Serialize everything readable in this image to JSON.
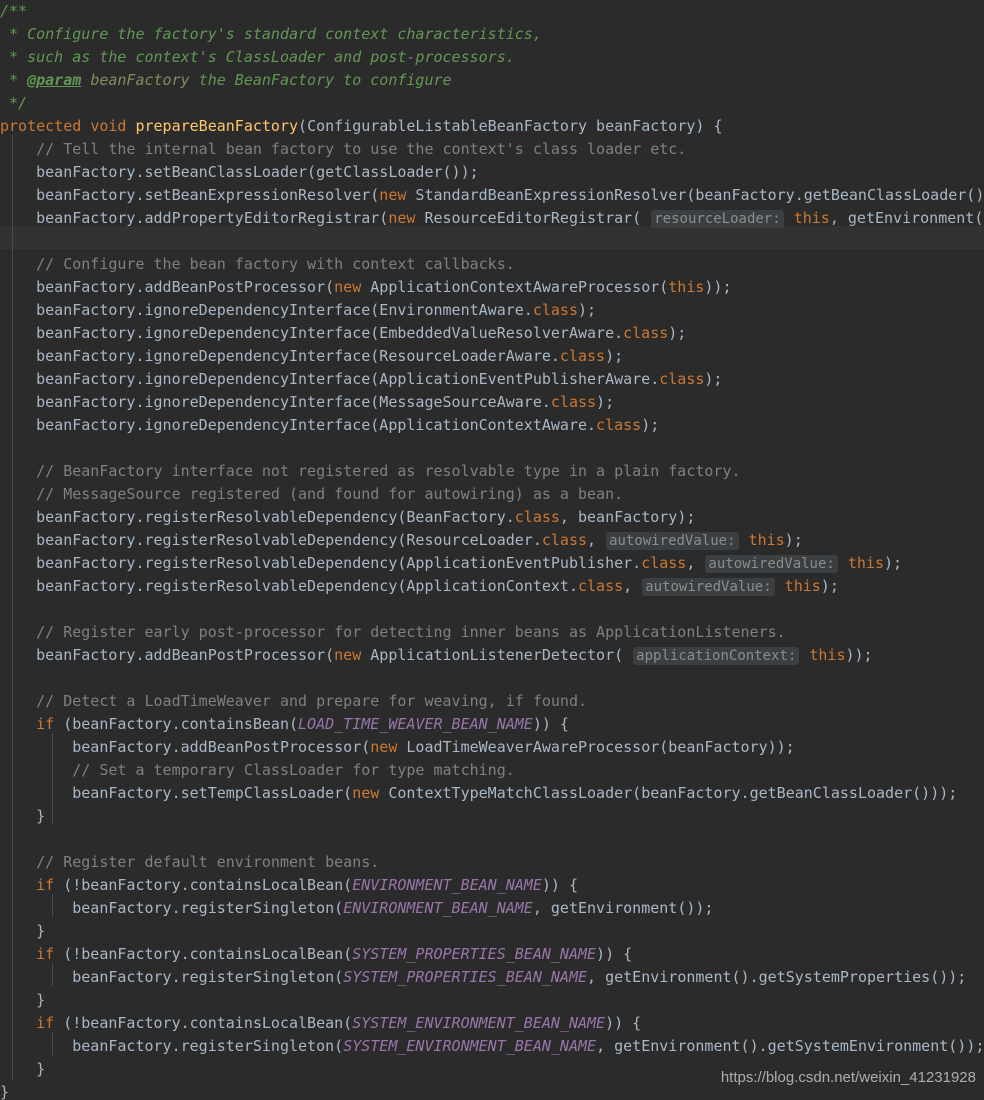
{
  "editor": {
    "language": "java",
    "theme": "darcula",
    "background_color": "#2b2b2b",
    "caret_line_color": "#323232",
    "default_text_color": "#a9b7c6",
    "colors": {
      "javadoc": "#629755",
      "javadoc_param_value": "#8a8a5c",
      "comment": "#808080",
      "keyword": "#cc7832",
      "method_declaration": "#ffc66d",
      "static_constant": "#9876aa",
      "identifier": "#a9b7c6",
      "hint_background": "#3c3f41",
      "hint_text": "#8c8c8c",
      "indent_guide": "#4b4b4b"
    }
  },
  "watermark": {
    "text": "https://blog.csdn.net/weixin_41231928"
  },
  "code": {
    "method_name": "prepareBeanFactory",
    "javadoc": {
      "open": "/**",
      "line1_star": " *",
      "line1_text": " Configure the factory's standard context characteristics,",
      "line2_star": " *",
      "line2_text": " such as the context's ClassLoader and post-processors.",
      "line3_star": " *",
      "line3_tag": "@param",
      "line3_param": "beanFactory",
      "line3_text": " the BeanFactory to configure",
      "close": " */"
    },
    "signature": {
      "modifier": "protected",
      "return_type": "void",
      "name": "prepareBeanFactory",
      "open_paren": "(",
      "param_type": "ConfigurableListableBeanFactory",
      "param_name": " beanFactory",
      "close": ") {"
    },
    "comments": {
      "tell_internal": "// Tell the internal bean factory to use the context's class loader etc.",
      "configure_callbacks": "// Configure the bean factory with context callbacks.",
      "beanfactory_interface": "// BeanFactory interface not registered as resolvable type in a plain factory.",
      "messagesource": "// MessageSource registered (and found for autowiring) as a bean.",
      "register_early": "// Register early post-processor for detecting inner beans as ApplicationListeners.",
      "detect_ltw": "// Detect a LoadTimeWeaver and prepare for weaving, if found.",
      "set_temp_cl": "// Set a temporary ClassLoader for type matching.",
      "register_default_env": "// Register default environment beans."
    },
    "hints": {
      "resource_loader": "resourceLoader:",
      "autowired_value": "autowiredValue:",
      "application_context": "applicationContext:"
    },
    "keywords": {
      "new": "new",
      "this": "this",
      "if": "if",
      "class": "class"
    },
    "constants": {
      "load_time_weaver": "LOAD_TIME_WEAVER_BEAN_NAME",
      "environment": "ENVIRONMENT_BEAN_NAME",
      "system_properties": "SYSTEM_PROPERTIES_BEAN_NAME",
      "system_environment": "SYSTEM_ENVIRONMENT_BEAN_NAME"
    },
    "statements": {
      "set_bean_class_loader": "beanFactory.setBeanClassLoader(getClassLoader());",
      "set_bean_expression_resolver_a": "beanFactory.setBeanExpressionResolver(",
      "set_bean_expression_resolver_b": " StandardBeanExpressionResolver(beanFactory.getBeanClassLoader()",
      "add_property_editor_registrar_a": "beanFactory.addPropertyEditorRegistrar(",
      "add_property_editor_registrar_b": " ResourceEditorRegistrar( ",
      "add_property_editor_registrar_c": ", getEnvironment())",
      "add_bean_post_processor_acap_a": "beanFactory.addBeanPostProcessor(",
      "add_bean_post_processor_acap_b": " ApplicationContextAwareProcessor(",
      "add_bean_post_processor_acap_c": "));",
      "ignore_environment_aware": "beanFactory.ignoreDependencyInterface(EnvironmentAware.",
      "ignore_embedded_value": "beanFactory.ignoreDependencyInterface(EmbeddedValueResolverAware.",
      "ignore_resource_loader": "beanFactory.ignoreDependencyInterface(ResourceLoaderAware.",
      "ignore_event_publisher": "beanFactory.ignoreDependencyInterface(ApplicationEventPublisherAware.",
      "ignore_message_source": "beanFactory.ignoreDependencyInterface(MessageSourceAware.",
      "ignore_app_context_aware": "beanFactory.ignoreDependencyInterface(ApplicationContextAware.",
      "ignore_suffix": ");",
      "reg_resolvable_beanfactory_a": "beanFactory.registerResolvableDependency(BeanFactory.",
      "reg_resolvable_beanfactory_b": ", beanFactory);",
      "reg_resolvable_resourceloader_a": "beanFactory.registerResolvableDependency(ResourceLoader.",
      "reg_resolvable_resourceloader_b": ", ",
      "reg_resolvable_eventpublisher_a": "beanFactory.registerResolvableDependency(ApplicationEventPublisher.",
      "reg_resolvable_appcontext_a": "beanFactory.registerResolvableDependency(ApplicationContext.",
      "reg_resolvable_tail": ");",
      "add_listener_detector_a": "beanFactory.addBeanPostProcessor(",
      "add_listener_detector_b": " ApplicationListenerDetector( ",
      "add_listener_detector_c": "));",
      "if_contains_bean_a": " (beanFactory.containsBean(",
      "if_contains_bean_b": ")) {",
      "add_ltw_processor_a": "beanFactory.addBeanPostProcessor(",
      "add_ltw_processor_b": " LoadTimeWeaverAwareProcessor(beanFactory));",
      "set_temp_class_loader_a": "beanFactory.setTempClassLoader(",
      "set_temp_class_loader_b": " ContextTypeMatchClassLoader(beanFactory.getBeanClassLoader()));",
      "if_not_contains_local_a": " (!beanFactory.containsLocalBean(",
      "if_not_contains_local_b": ")) {",
      "reg_singleton_env_a": "beanFactory.registerSingleton(",
      "reg_singleton_env_b": ", getEnvironment());",
      "reg_singleton_sysprops_b": ", getEnvironment().getSystemProperties());",
      "reg_singleton_sysenv_b": ", getEnvironment().getSystemEnvironment());",
      "close_brace": "}",
      "close_brace_indent": "    }",
      "method_close_brace": "}"
    }
  }
}
